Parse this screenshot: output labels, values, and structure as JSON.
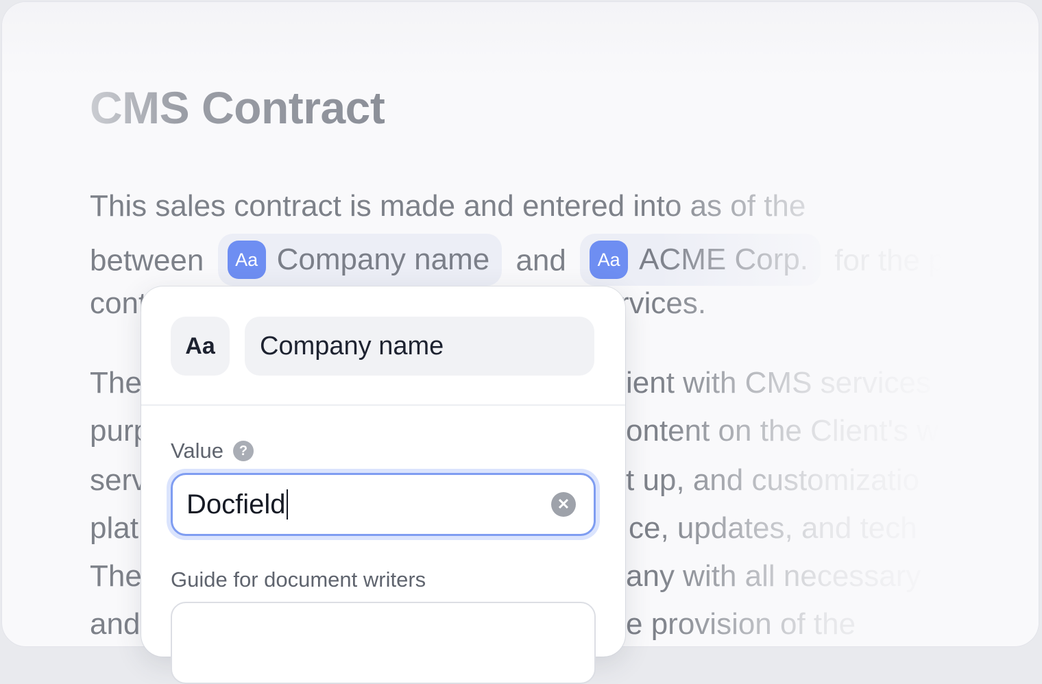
{
  "document": {
    "title": "CMS Contract",
    "lines": [
      {
        "text": "This sales contract  is made and entered into as of the"
      },
      {
        "before": "between",
        "chip1": {
          "icon_text": "Aa",
          "label": "Company name"
        },
        "middle": "and",
        "chip2": {
          "icon_text": "Aa",
          "label": "ACME Corp."
        },
        "after": "for the p"
      },
      {
        "left": "cont",
        "right": "rvices."
      },
      {
        "left": "The",
        "right": "ient with CMS services"
      },
      {
        "left": "purp",
        "right": "ontent on the Client's w"
      },
      {
        "left": "serv",
        "right": "t up, and customizatio"
      },
      {
        "left": "plat",
        "right": "ce, updates, and tech"
      },
      {
        "left": "The",
        "right": "any with all necessary"
      },
      {
        "left": "and",
        "right": "e provision of the"
      }
    ]
  },
  "popover": {
    "type_icon_text": "Aa",
    "field_name": "Company name",
    "value_label": "Value",
    "value": "Docfield",
    "guide_label": "Guide for document writers",
    "guide_value": ""
  },
  "colors": {
    "accent": "#6e8ef2",
    "focus_ring": "#7f9df1",
    "background": "#f9f9fb"
  },
  "icons": {
    "chip_icon": "text-type-icon",
    "help": "question-circle-icon",
    "clear": "clear-x-circle-icon"
  }
}
